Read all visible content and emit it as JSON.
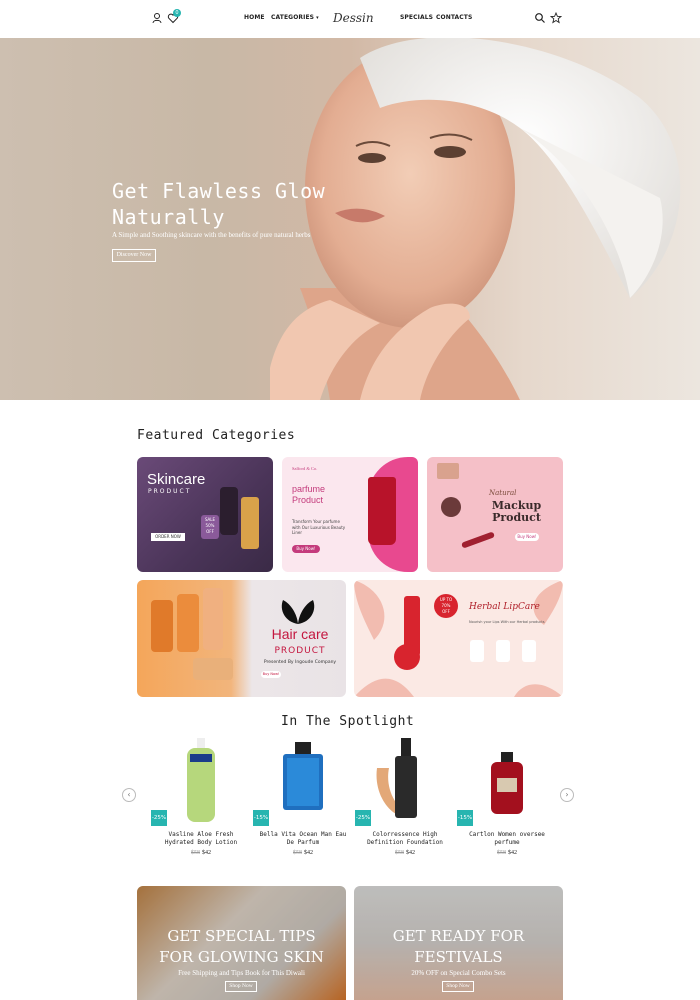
{
  "header": {
    "nav": {
      "home": "HOME",
      "categories": "CATEGORIES",
      "specials": "SPECIALS",
      "contacts": "CONTACTS"
    },
    "logo": "Dessin",
    "cart_count": "0"
  },
  "hero": {
    "title": "Get Flawless Glow\nNaturally",
    "subtitle": "A Simple and Soothing skincare with the benefits of pure natural herbs",
    "button": "Discover Now"
  },
  "featured": {
    "title": "Featured Categories",
    "cards": [
      {
        "title": "Skincare",
        "sub": "PRODUCT",
        "badge": "SALE\n50%\nOFF",
        "cta": "ORDER NOW"
      },
      {
        "brand": "Salford & Co.",
        "title": "parfume\nProduct",
        "desc": "Transform Your parfume\nwith Our Luxurious Beauty\nLiner",
        "cta": "Buy Now!"
      },
      {
        "script": "Natural",
        "title": "Mackup\nProduct",
        "cta": "Buy Now!"
      },
      {
        "title": "Hair care",
        "sub": "PRODUCT",
        "desc": "Presented By Ingoude Company",
        "cta": "Buy Now!"
      },
      {
        "badge": "UP TO\n70%\nOFF",
        "title": "Herbal LipCare",
        "desc": "Nourish your Lips With our Herbal products"
      }
    ]
  },
  "spotlight": {
    "title": "In The Spotlight",
    "products": [
      {
        "name": "Vasline Aloe Fresh\nHydrated Body Lotion",
        "old_price": "$58",
        "price": "$42",
        "discount": "-25%"
      },
      {
        "name": "Bella Vita Ocean Man Eau\nDe Parfum",
        "old_price": "$58",
        "price": "$42",
        "discount": "-15%"
      },
      {
        "name": "Colorressence High\nDefinition Foundation",
        "old_price": "$58",
        "price": "$42",
        "discount": "-25%"
      },
      {
        "name": "Cartlon Women oversee\nperfume",
        "old_price": "$58",
        "price": "$42",
        "discount": "-15%"
      }
    ]
  },
  "promos": [
    {
      "title": "GET SPECIAL TIPS\nFOR GLOWING SKIN",
      "sub": "Free Shipping and Tips Book for This Diwali",
      "button": "Shop Now"
    },
    {
      "title": "GET READY FOR\nFESTIVALS",
      "sub": "20% OFF on Special Combo Sets",
      "button": "Shop Now"
    }
  ],
  "colors": {
    "accent": "#27b5b0",
    "text": "#222222"
  }
}
